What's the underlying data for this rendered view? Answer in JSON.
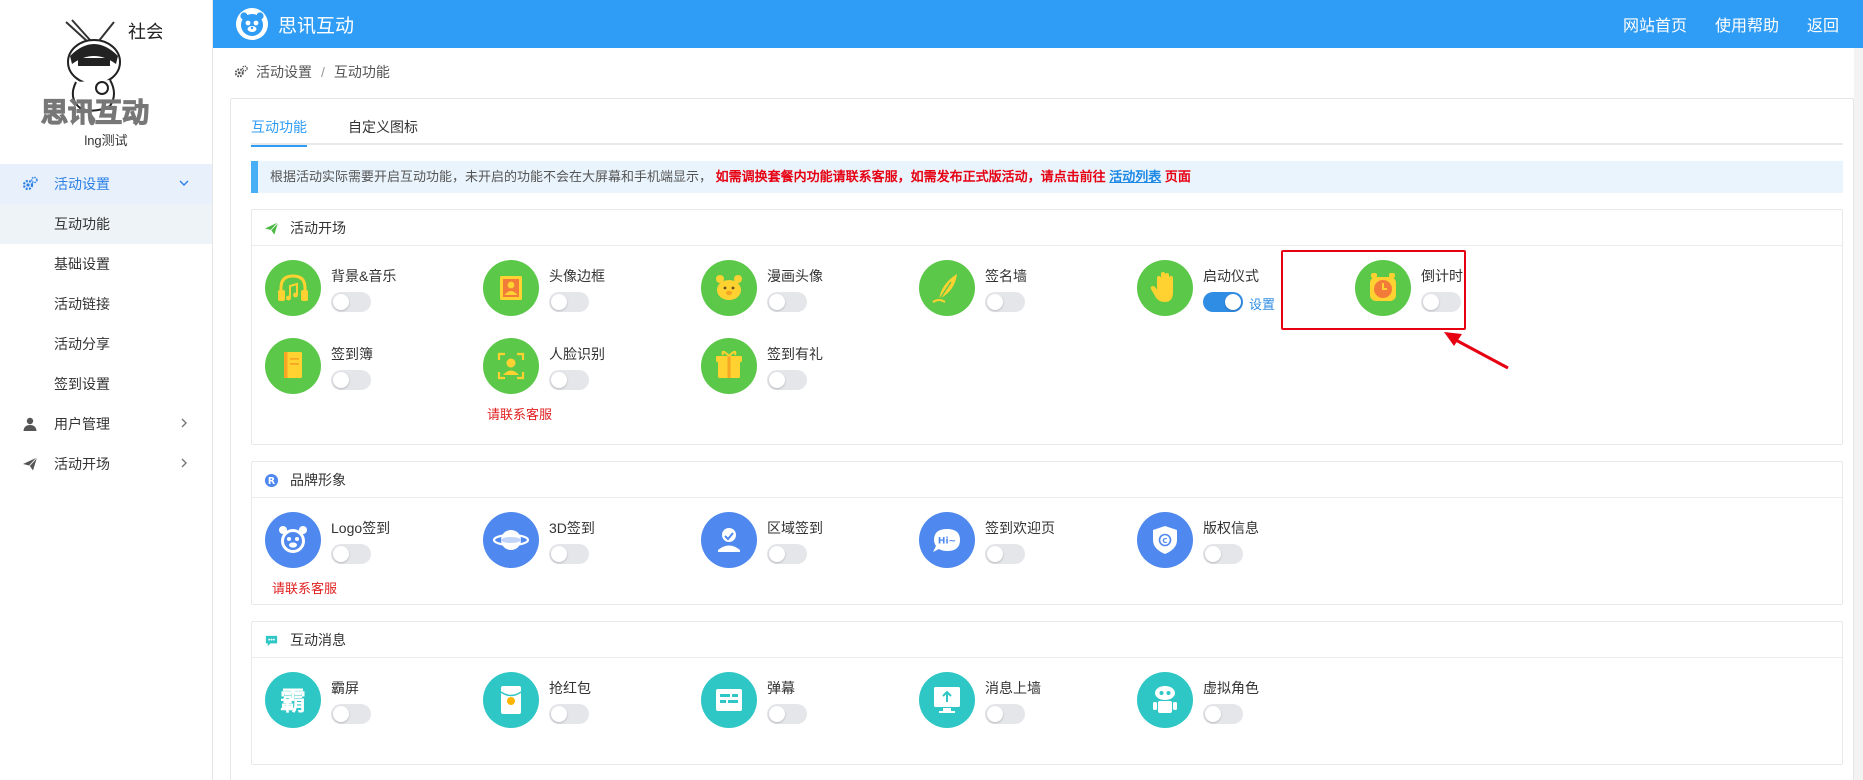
{
  "sidebar": {
    "account_name": "lng测试",
    "logo_text": "思讯互动",
    "logo_stamp": "社会",
    "menu": [
      {
        "label": "活动设置",
        "icon": "gear-icon",
        "expanded": true,
        "children": [
          {
            "label": "互动功能",
            "current": true
          },
          {
            "label": "基础设置"
          },
          {
            "label": "活动链接"
          },
          {
            "label": "活动分享"
          },
          {
            "label": "签到设置"
          }
        ]
      },
      {
        "label": "用户管理",
        "icon": "user-icon"
      },
      {
        "label": "活动开场",
        "icon": "paper-plane-icon"
      }
    ]
  },
  "header": {
    "brand": "思讯互动",
    "links": [
      "网站首页",
      "使用帮助",
      "返回"
    ]
  },
  "breadcrumb": {
    "items": [
      "活动设置",
      "互动功能"
    ]
  },
  "tabs": [
    {
      "label": "互动功能",
      "active": true
    },
    {
      "label": "自定义图标",
      "active": false
    }
  ],
  "notice": {
    "text": "根据活动实际需要开启互动功能，未开启的功能不会在大屏幕和手机端显示，",
    "emphasis": "如需调换套餐内功能请联系客服，如需发布正式版活动，请点击前往",
    "link": "活动列表",
    "suffix": "页面"
  },
  "sections": [
    {
      "title": "活动开场",
      "icon": "paper-plane-icon",
      "features": [
        {
          "name": "背景&音乐",
          "icon": "headphone-icon",
          "on": false
        },
        {
          "name": "头像边框",
          "icon": "portrait-frame-icon",
          "on": false
        },
        {
          "name": "漫画头像",
          "icon": "bear-face-icon",
          "on": false
        },
        {
          "name": "签名墙",
          "icon": "quill-icon",
          "on": false
        },
        {
          "name": "启动仪式",
          "icon": "hand-icon",
          "on": true,
          "settings": "设置"
        },
        {
          "name": "倒计时",
          "icon": "alarm-clock-icon",
          "on": false
        },
        {
          "name": "签到簿",
          "icon": "book-icon",
          "on": false
        },
        {
          "name": "人脸识别",
          "icon": "face-scan-icon",
          "on": false,
          "contact": "请联系客服"
        },
        {
          "name": "签到有礼",
          "icon": "gift-icon",
          "on": false
        }
      ]
    },
    {
      "title": "品牌形象",
      "icon": "registered-icon",
      "features": [
        {
          "name": "Logo签到",
          "icon": "logo-face-icon",
          "on": false,
          "contact": "请联系客服"
        },
        {
          "name": "3D签到",
          "icon": "planet-icon",
          "on": false
        },
        {
          "name": "区域签到",
          "icon": "location-person-icon",
          "on": false
        },
        {
          "name": "签到欢迎页",
          "icon": "hi-bubble-icon",
          "on": false
        },
        {
          "name": "版权信息",
          "icon": "copyright-shield-icon",
          "on": false
        }
      ]
    },
    {
      "title": "互动消息",
      "icon": "chat-icon",
      "features": [
        {
          "name": "霸屏",
          "icon": "ba-character-icon",
          "glyph": "霸",
          "on": false
        },
        {
          "name": "抢红包",
          "icon": "red-envelope-icon",
          "on": false
        },
        {
          "name": "弹幕",
          "icon": "danmaku-icon",
          "on": false
        },
        {
          "name": "消息上墙",
          "icon": "screen-upload-icon",
          "on": false
        },
        {
          "name": "虚拟角色",
          "icon": "robot-icon",
          "on": false
        }
      ]
    }
  ],
  "colors": {
    "header": "#2f9cf5",
    "green_icon": "#5cc84a",
    "blue_icon": "#4f88ee",
    "teal_icon": "#2ec7c5",
    "toggle_on": "#2f8de4",
    "alert_red": "#e60012"
  }
}
